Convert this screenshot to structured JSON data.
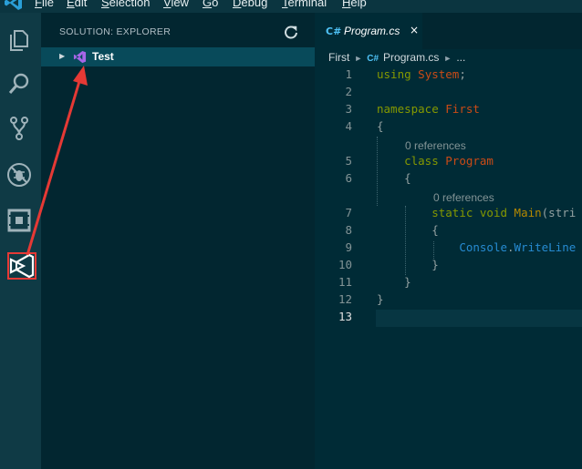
{
  "menubar": {
    "items": [
      {
        "label": "File",
        "underline": "F",
        "rest": "ile"
      },
      {
        "label": "Edit",
        "underline": "E",
        "rest": "dit"
      },
      {
        "label": "Selection",
        "underline": "S",
        "rest": "election"
      },
      {
        "label": "View",
        "underline": "V",
        "rest": "iew"
      },
      {
        "label": "Go",
        "underline": "G",
        "rest": "o"
      },
      {
        "label": "Debug",
        "underline": "D",
        "rest": "ebug"
      },
      {
        "label": "Terminal",
        "underline": "T",
        "rest": "erminal"
      },
      {
        "label": "Help",
        "underline": "H",
        "rest": "elp"
      }
    ]
  },
  "activitybar": {
    "icons": [
      "explorer-icon",
      "search-icon",
      "source-control-icon",
      "debug-icon",
      "extensions-icon",
      "solution-explorer-icon"
    ],
    "highlight_color": "#e53935"
  },
  "sidebar": {
    "title": "SOLUTION: EXPLORER",
    "tree": [
      {
        "label": "Test",
        "expanded": false,
        "icon": "visual-studio-icon"
      }
    ]
  },
  "editor": {
    "tab": {
      "badge": "C#",
      "label": "Program.cs",
      "close": "×"
    },
    "breadcrumb": {
      "first": "First",
      "badge": "C#",
      "file": "Program.cs",
      "more": "..."
    },
    "codelens": [
      "0 references",
      "0 references"
    ],
    "line_numbers": [
      "1",
      "2",
      "3",
      "4",
      "5",
      "6",
      "7",
      "8",
      "9",
      "10",
      "11",
      "12",
      "13"
    ],
    "lines": {
      "l1_kw": "using",
      "l1_ns": "System",
      "l1_end": ";",
      "l3_kw": "namespace",
      "l3_ns": "First",
      "l4": "{",
      "l5_kw": "class",
      "l5_name": "Program",
      "l6": "{",
      "l7_kw1": "static",
      "l7_kw2": "void",
      "l7_fn": "Main",
      "l7_rest": "(stri",
      "l8": "{",
      "l9_cls": "Console",
      "l9_dot": ".",
      "l9_fn": "WriteLine",
      "l10": "}",
      "l11": "}",
      "l12": "}"
    }
  },
  "colors": {
    "arrow": "#e53935",
    "selection": "#084a5a"
  }
}
